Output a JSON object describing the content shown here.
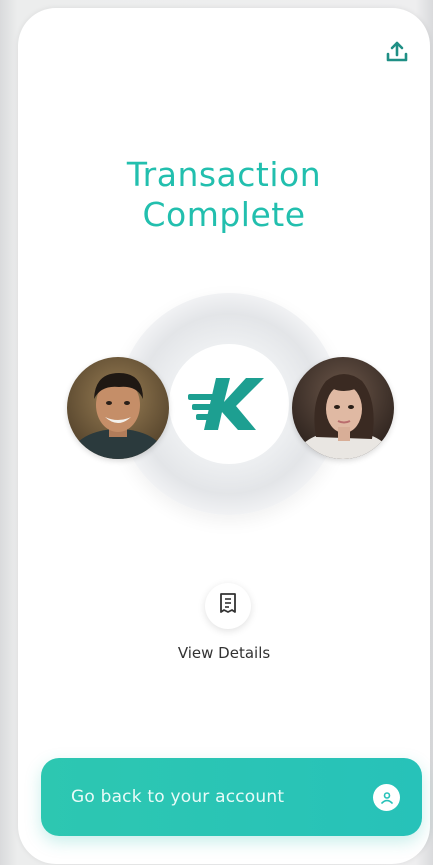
{
  "header": {
    "share_icon": "upload-share-icon"
  },
  "main": {
    "title": "Transaction\nComplete",
    "logo_icon": "k-brand-logo-icon",
    "sender_avatar": "man-avatar",
    "recipient_avatar": "woman-avatar",
    "view_details_label": "View Details",
    "details_icon": "receipt-icon"
  },
  "footer": {
    "cta_label": "Go back to your account",
    "cta_icon": "user-icon"
  },
  "colors": {
    "accent": "#22bfae",
    "cta_gradient_start": "#2dc7b1",
    "cta_gradient_end": "#27c2b9"
  }
}
